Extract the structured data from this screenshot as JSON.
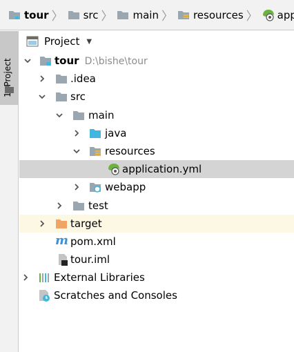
{
  "breadcrumb": [
    {
      "label": "tour",
      "icon": "module-folder-icon",
      "bold": true
    },
    {
      "label": "src",
      "icon": "folder-icon",
      "bold": false
    },
    {
      "label": "main",
      "icon": "folder-icon",
      "bold": false
    },
    {
      "label": "resources",
      "icon": "resources-folder-icon",
      "bold": false
    },
    {
      "label": "application",
      "icon": "spring-config-icon",
      "bold": false
    }
  ],
  "stripe": {
    "label": "1: Project"
  },
  "panel": {
    "title": "Project"
  },
  "tree": [
    {
      "label": "tour",
      "extra": "D:\\bishe\\tour",
      "arrow": "down",
      "icon": "module-folder-icon",
      "bold": true
    },
    {
      "label": ".idea",
      "arrow": "right",
      "icon": "folder-icon"
    },
    {
      "label": "src",
      "arrow": "down",
      "icon": "folder-icon"
    },
    {
      "label": "main",
      "arrow": "down",
      "icon": "folder-icon"
    },
    {
      "label": "java",
      "arrow": "right",
      "icon": "source-folder-icon"
    },
    {
      "label": "resources",
      "arrow": "down",
      "icon": "resources-folder-icon"
    },
    {
      "label": "application.yml",
      "arrow": "none",
      "icon": "spring-config-icon",
      "selected": true
    },
    {
      "label": "webapp",
      "arrow": "right",
      "icon": "web-folder-icon"
    },
    {
      "label": "test",
      "arrow": "right",
      "icon": "folder-icon"
    },
    {
      "label": "target",
      "arrow": "right",
      "icon": "excluded-folder-icon",
      "excluded": true
    },
    {
      "label": "pom.xml",
      "arrow": "none",
      "icon": "maven-icon"
    },
    {
      "label": "tour.iml",
      "arrow": "none",
      "icon": "iml-file-icon"
    },
    {
      "label": "External Libraries",
      "arrow": "right",
      "icon": "libraries-icon"
    },
    {
      "label": "Scratches and Consoles",
      "arrow": "none",
      "icon": "scratches-icon"
    }
  ],
  "colors": {
    "selection": "#d4d4d4",
    "excluded_bg": "#fdf8e4",
    "folder": "#9aa7b0",
    "excluded_folder": "#f0a565",
    "source_folder": "#40b6e0",
    "spring": "#6db33f"
  }
}
